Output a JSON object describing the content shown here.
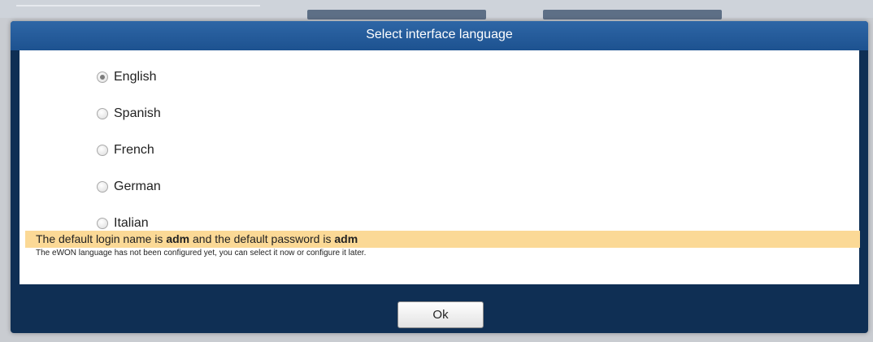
{
  "dialog": {
    "title": "Select interface language",
    "languages": [
      {
        "label": "English",
        "selected": true
      },
      {
        "label": "Spanish",
        "selected": false
      },
      {
        "label": "French",
        "selected": false
      },
      {
        "label": "German",
        "selected": false
      },
      {
        "label": "Italian",
        "selected": false
      }
    ],
    "note": "The eWON language has not been configured yet, you can select it now or configure it later.",
    "notice": {
      "prefix": "The default login name is ",
      "login": "adm",
      "middle": " and the default password is ",
      "password": "adm"
    },
    "ok_label": "Ok"
  },
  "colors": {
    "titlebar": "#1d5290",
    "frame": "#0f2f54",
    "notice_bg": "#fbd996"
  }
}
